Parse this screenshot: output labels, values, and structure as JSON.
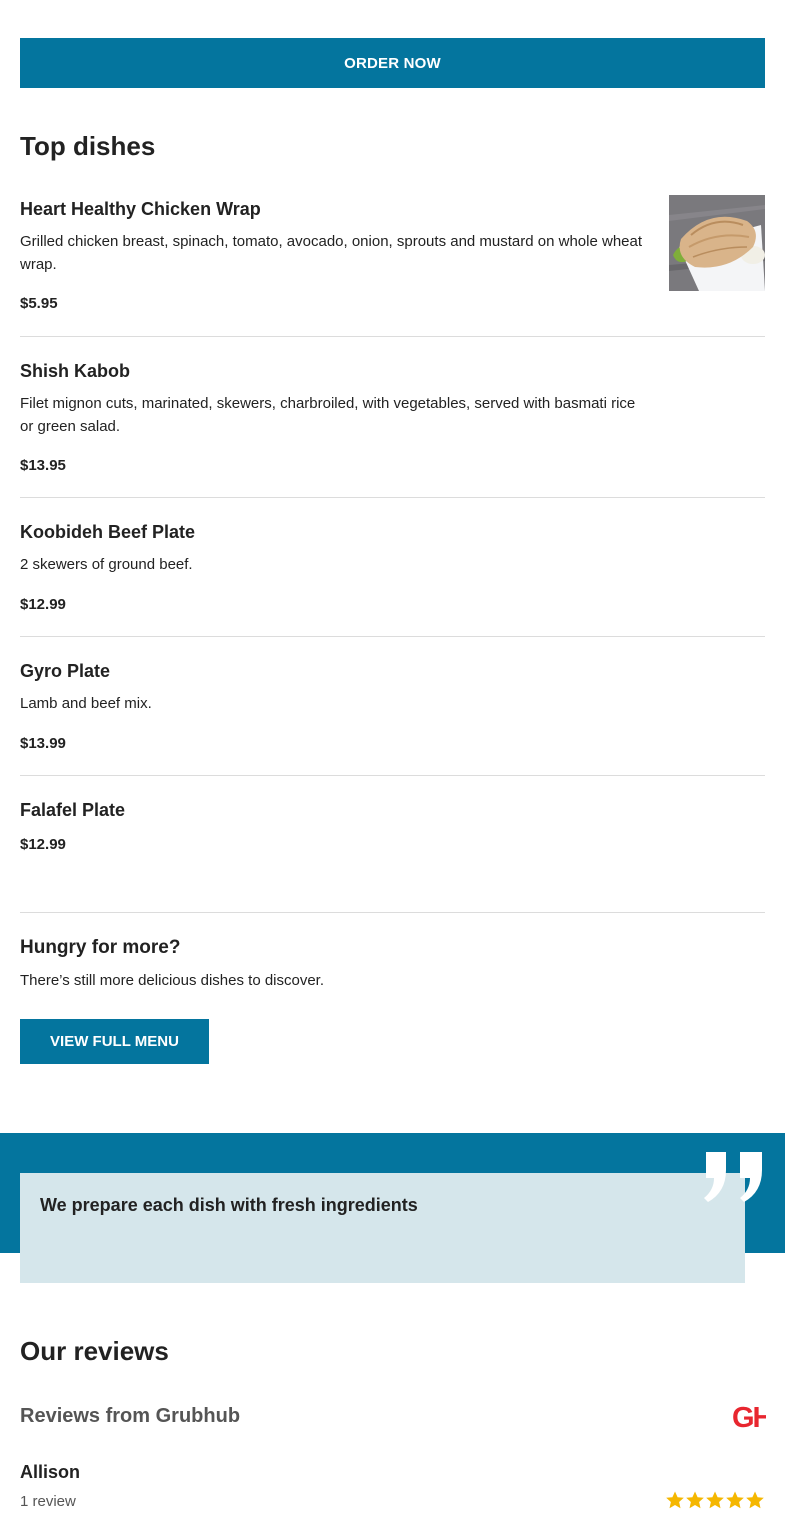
{
  "order_button": {
    "label": "ORDER NOW"
  },
  "top_dishes": {
    "title": "Top dishes",
    "dishes": [
      {
        "name": "Heart Healthy Chicken Wrap",
        "description": "Grilled chicken breast, spinach, tomato, avocado, onion, sprouts and mustard on whole wheat wrap.",
        "price": "$5.95",
        "has_image": true
      },
      {
        "name": "Shish Kabob",
        "description": "Filet mignon cuts, marinated, skewers, charbroiled, with vegetables, served with basmati rice or green salad.",
        "price": "$13.95"
      },
      {
        "name": "Koobideh Beef Plate",
        "description": "2 skewers of ground beef.",
        "price": "$12.99"
      },
      {
        "name": "Gyro Plate",
        "description": "Lamb and beef mix.",
        "price": "$13.99"
      },
      {
        "name": "Falafel Plate",
        "description": "",
        "price": "$12.99"
      }
    ]
  },
  "more": {
    "title": "Hungry for more?",
    "text": "There’s still more delicious dishes to discover.",
    "button_label": "VIEW FULL MENU"
  },
  "quote": {
    "text": "We prepare each dish with fresh ingredients",
    "icon": "quote-mark-icon"
  },
  "reviews": {
    "title": "Our reviews",
    "source_label": "Reviews from Grubhub",
    "logo_text": "GH",
    "items": [
      {
        "name": "Allison",
        "count": "1 review",
        "rating": 5
      }
    ]
  },
  "colors": {
    "accent": "#04759e",
    "quote_box": "#d5e6eb",
    "star": "#f5b700",
    "grubhub": "#e8262f"
  }
}
